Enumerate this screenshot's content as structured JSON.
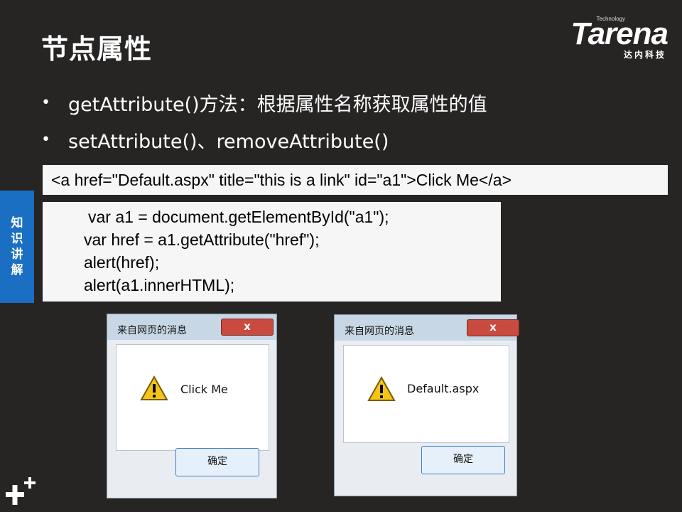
{
  "slide": {
    "title": "节点属性",
    "bullets": [
      "getAttribute()方法：根据属性名称获取属性的值",
      "setAttribute()、removeAttribute()"
    ]
  },
  "logo": {
    "tagline": "Technology",
    "name": "Tarena",
    "chinese": "达内科技"
  },
  "side_tab": [
    "知",
    "识",
    "讲",
    "解"
  ],
  "html_example": "<a href=\"Default.aspx\" title=\"this is a link\" id=\"a1\">Click Me</a>",
  "code_lines": [
    "var a1 = document.getElementById(\"a1\");",
    "var href = a1.getAttribute(\"href\");",
    "alert(href);",
    "alert(a1.innerHTML);"
  ],
  "dialogs": [
    {
      "title": "来自网页的消息",
      "close_label": "x",
      "message": "Click Me",
      "ok_label": "确定"
    },
    {
      "title": "来自网页的消息",
      "close_label": "x",
      "message": "Default.aspx",
      "ok_label": "确定"
    }
  ],
  "colors": {
    "background": "#272524",
    "side_tab": "#1a6fc2",
    "close_button": "#c94a3e"
  }
}
